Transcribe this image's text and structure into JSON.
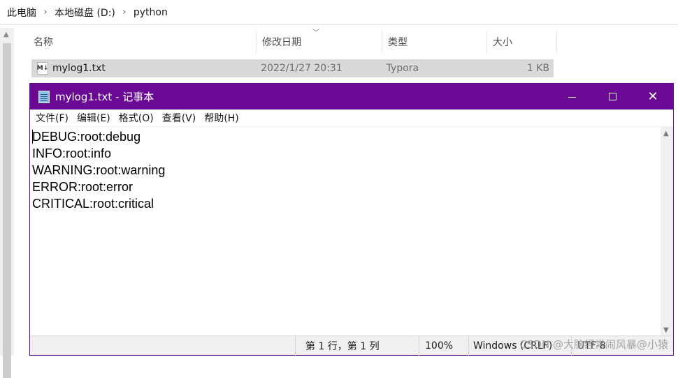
{
  "explorer": {
    "breadcrumb": [
      "此电脑",
      "本地磁盘 (D:)",
      "python"
    ],
    "breadcrumb_separator": "›",
    "columns": {
      "name": "名称",
      "date": "修改日期",
      "type": "类型",
      "size": "大小"
    },
    "files": [
      {
        "name": "mylog1.txt",
        "modified": "2022/1/27 20:31",
        "type": "Typora",
        "size": "1 KB"
      }
    ]
  },
  "notepad": {
    "title": "mylog1.txt - 记事本",
    "menu": [
      "文件(F)",
      "编辑(E)",
      "格式(O)",
      "查看(V)",
      "帮助(H)"
    ],
    "content_lines": [
      "DEBUG:root:debug",
      "INFO:root:info",
      "WARNING:root:warning",
      "ERROR:root:error",
      "CRITICAL:root:critical"
    ],
    "status": {
      "position": "第 1 行，第 1 列",
      "zoom": "100%",
      "line_ending": "Windows (CRLF)",
      "encoding": "UTF-8"
    },
    "titlebar_color": "#6a0a94"
  },
  "watermark": "CSDN @大脑经常闹风暴@小猿",
  "icons": {
    "file": "typora-file-icon",
    "app": "notepad-icon",
    "minimize": "minimize-icon",
    "maximize": "maximize-icon",
    "close": "close-icon"
  }
}
